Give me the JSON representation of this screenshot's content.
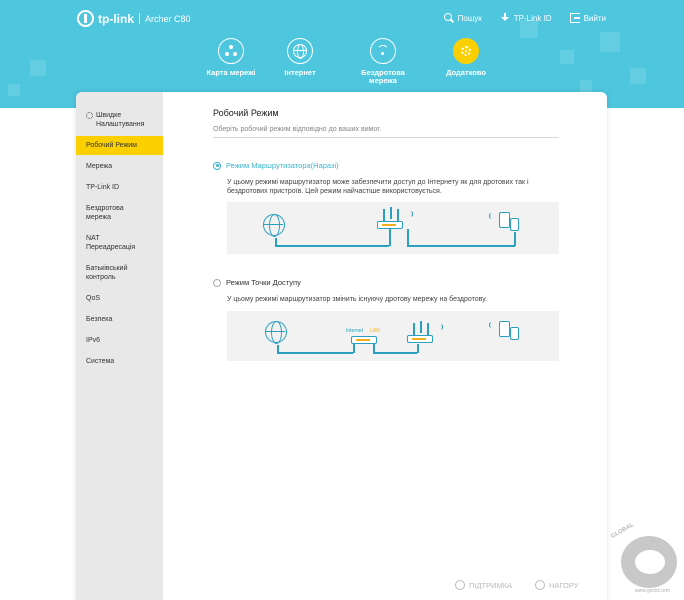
{
  "header": {
    "logo": "tp-link",
    "model": "Archer C80",
    "links": [
      {
        "label": "Пошук",
        "icon": "search-icon"
      },
      {
        "label": "TP-Link ID",
        "icon": "download-icon"
      },
      {
        "label": "Вийти",
        "icon": "logout-icon"
      }
    ],
    "nav": [
      {
        "label": "Карта мережі",
        "icon": "network-map-icon"
      },
      {
        "label": "Інтернет",
        "icon": "globe-icon"
      },
      {
        "label": "Бездротова мережа",
        "icon": "wifi-icon"
      },
      {
        "label": "Додатково",
        "icon": "gear-icon",
        "active": true
      }
    ]
  },
  "sidebar": {
    "items": [
      {
        "label": "Швидке Налаштування"
      },
      {
        "label": "Робочий Режим",
        "active": true
      },
      {
        "label": "Мережа"
      },
      {
        "label": "TP-Link ID"
      },
      {
        "label": "Бездротова мережа"
      },
      {
        "label": "NAT Переадресація"
      },
      {
        "label": "Батьківський контроль"
      },
      {
        "label": "QoS"
      },
      {
        "label": "Безпека"
      },
      {
        "label": "IPv6"
      },
      {
        "label": "Система"
      }
    ]
  },
  "main": {
    "title": "Робочий Режим",
    "subtitle": "Оберіть робочий режим відповідно до ваших вимог.",
    "options": [
      {
        "label": "Режим Маршрутизатора(Наразі)",
        "selected": true,
        "description": "У цьому режимі маршрутизатор може забезпечити доступ до Інтернету як для дротових так і бездротових пристроїв. Цей режим найчастіше використовується."
      },
      {
        "label": "Режим Точки Доступу",
        "selected": false,
        "description": "У цьому режимі маршрутизатор змінить існуючу дротову мережу на бездротову."
      }
    ],
    "diagram_labels": {
      "internet": "Internet",
      "lan": "LAN"
    }
  },
  "footer": {
    "support": "ПІДТРИМКА",
    "top": "НАГОРУ"
  },
  "watermark": {
    "brand": "GLOBAL",
    "site": "www.gecid.com"
  },
  "colors": {
    "header": "#4ec6de",
    "accent": "#fcd000",
    "link": "#3ab5cf"
  }
}
